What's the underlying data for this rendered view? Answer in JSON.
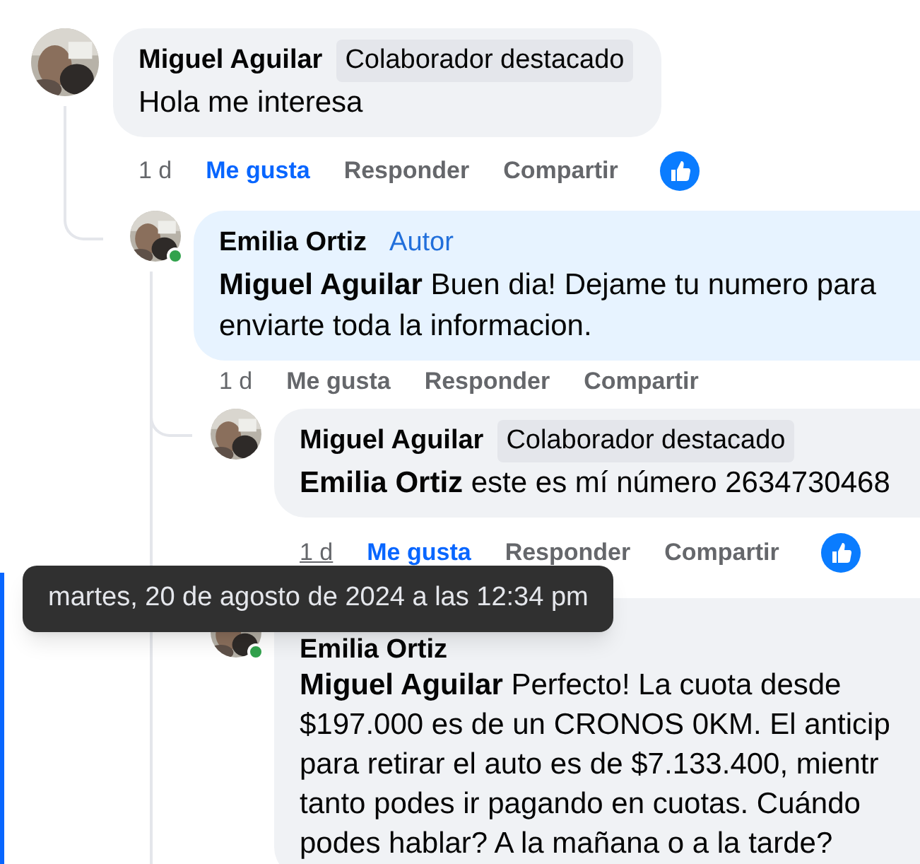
{
  "comments": [
    {
      "author": "Miguel Aguilar",
      "badge": {
        "kind": "top_fan",
        "label": "Colaborador destacado"
      },
      "online": false,
      "text": "Hola me interesa",
      "time": "1 d",
      "time_hovered": false,
      "like": {
        "label": "Me gusta",
        "selected": true
      },
      "reply": "Responder",
      "share": "Compartir",
      "reaction": true,
      "children": [
        {
          "author": "Emilia Ortiz",
          "badge": {
            "kind": "author",
            "label": "Autor"
          },
          "online": true,
          "text": "**Miguel Aguilar** Buen dia! Dejame tu numero para\nenviarte toda la informacion.",
          "time": "1 d",
          "time_hovered": false,
          "like": {
            "label": "Me gusta",
            "selected": false
          },
          "reply": "Responder",
          "share": "Compartir",
          "reaction": false,
          "children": [
            {
              "author": "Miguel Aguilar",
              "badge": {
                "kind": "top_fan",
                "label": "Colaborador destacado"
              },
              "online": false,
              "text": "**Emilia Ortiz** este es mí número 2634730468",
              "time": "1 d",
              "time_hovered": true,
              "like": {
                "label": "Me gusta",
                "selected": true
              },
              "reply": "Responder",
              "share": "Compartir",
              "reaction": true
            },
            {
              "author": "Emilia Ortiz",
              "online": true,
              "text": "**Miguel Aguilar** Perfecto! La cuota desde\n$197.000 es de un CRONOS 0KM. El anticip\npara retirar el auto es de $7.133.400, mientr\ntanto podes ir pagando en cuotas. Cuándo\npodes hablar? A la mañana o a la tarde?"
            }
          ]
        }
      ]
    }
  ],
  "tooltip": "martes, 20 de agosto de 2024 a las 12:34 pm"
}
